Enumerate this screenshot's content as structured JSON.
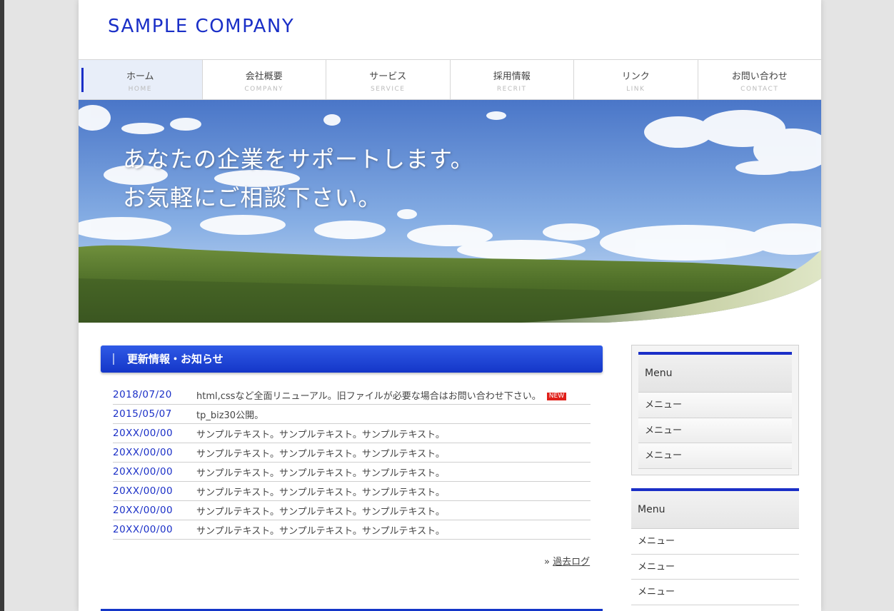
{
  "header": {
    "logo_text": "SAMPLE COMPANY"
  },
  "nav": {
    "items": [
      {
        "label": "ホーム",
        "sub": "HOME",
        "active": true
      },
      {
        "label": "会社概要",
        "sub": "COMPANY"
      },
      {
        "label": "サービス",
        "sub": "SERVICE"
      },
      {
        "label": "採用情報",
        "sub": "RECRIT"
      },
      {
        "label": "リンク",
        "sub": "LINK"
      },
      {
        "label": "お問い合わせ",
        "sub": "CONTACT"
      }
    ]
  },
  "hero": {
    "line1": "あなたの企業をサポートします。",
    "line2": "お気軽にご相談下さい。"
  },
  "news": {
    "heading": "更新情報・お知らせ",
    "new_badge": "NEW",
    "items": [
      {
        "date": "2018/07/20",
        "text": "html,cssなど全面リニューアル。旧ファイルが必要な場合はお問い合わせ下さい。"
      },
      {
        "date": "2015/05/07",
        "text": "tp_biz30公開。"
      },
      {
        "date": "20XX/00/00",
        "text": "サンプルテキスト。サンプルテキスト。サンプルテキスト。"
      },
      {
        "date": "20XX/00/00",
        "text": "サンプルテキスト。サンプルテキスト。サンプルテキスト。"
      },
      {
        "date": "20XX/00/00",
        "text": "サンプルテキスト。サンプルテキスト。サンプルテキスト。"
      },
      {
        "date": "20XX/00/00",
        "text": "サンプルテキスト。サンプルテキスト。サンプルテキスト。"
      },
      {
        "date": "20XX/00/00",
        "text": "サンプルテキスト。サンプルテキスト。サンプルテキスト。"
      },
      {
        "date": "20XX/00/00",
        "text": "サンプルテキスト。サンプルテキスト。サンプルテキスト。"
      }
    ],
    "archive_prefix": "»",
    "archive_link": "過去ログ"
  },
  "sidebar": {
    "menu1": {
      "title": "Menu",
      "items": [
        "メニュー",
        "メニュー",
        "メニュー"
      ]
    },
    "menu2": {
      "title": "Menu",
      "items": [
        "メニュー",
        "メニュー",
        "メニュー"
      ]
    }
  },
  "colors": {
    "accent": "#1a2fc7",
    "new_badge": "#e0201a"
  }
}
